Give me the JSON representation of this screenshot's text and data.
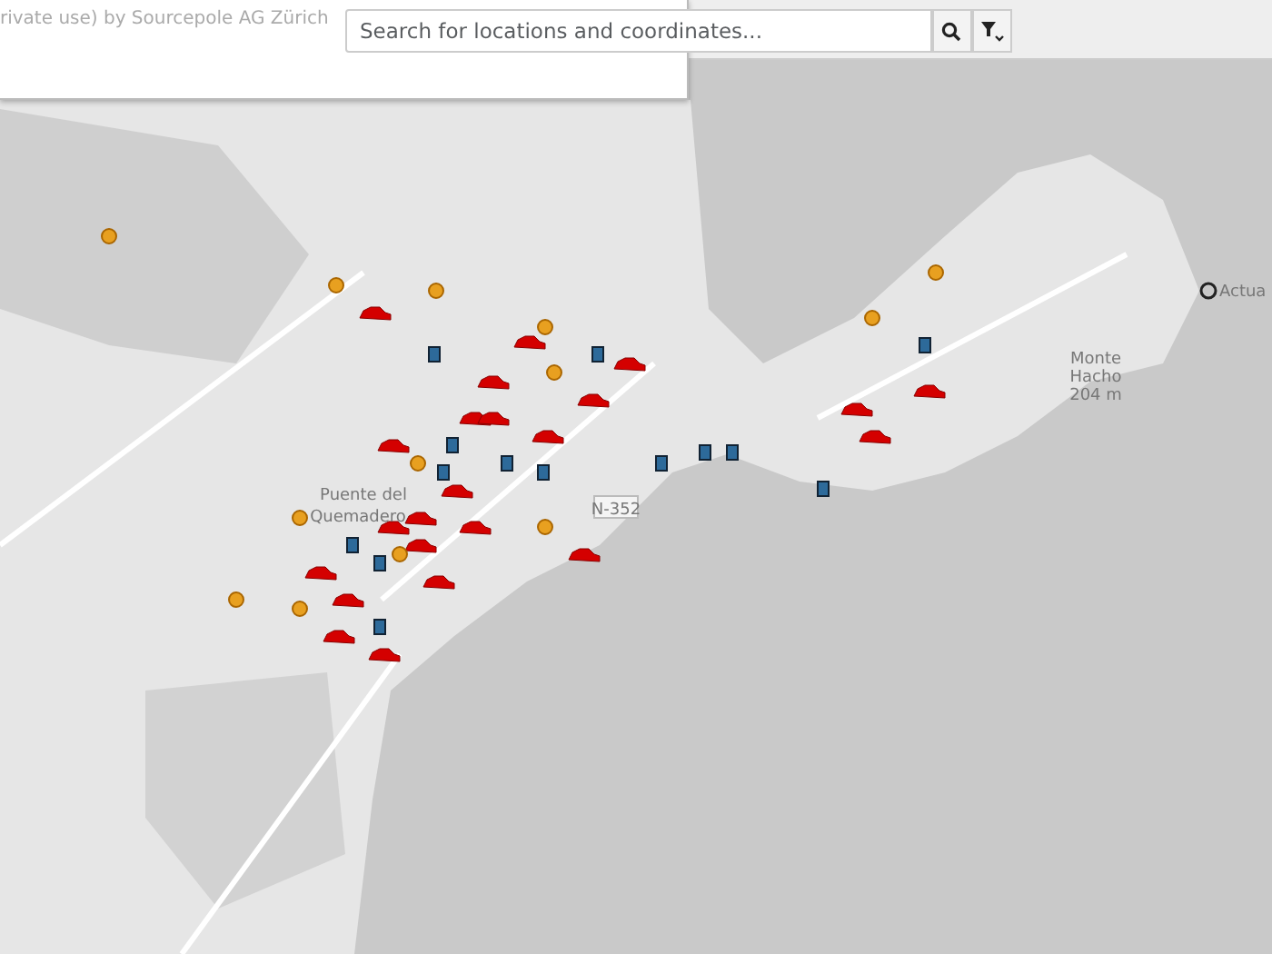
{
  "attribution": {
    "text": "rivate use) by Sourcepole AG Zürich"
  },
  "search": {
    "placeholder": "Search for locations and coordinates..."
  },
  "map_labels": [
    {
      "text": "Puente del",
      "kind": "place"
    },
    {
      "text": "Quemadero",
      "kind": "place"
    },
    {
      "text": "N-352",
      "kind": "road"
    },
    {
      "text": "Monte",
      "kind": "place"
    },
    {
      "text": "Hacho",
      "kind": "place"
    },
    {
      "text": "204 m",
      "kind": "place"
    },
    {
      "text": "Actua",
      "kind": "marker"
    }
  ]
}
